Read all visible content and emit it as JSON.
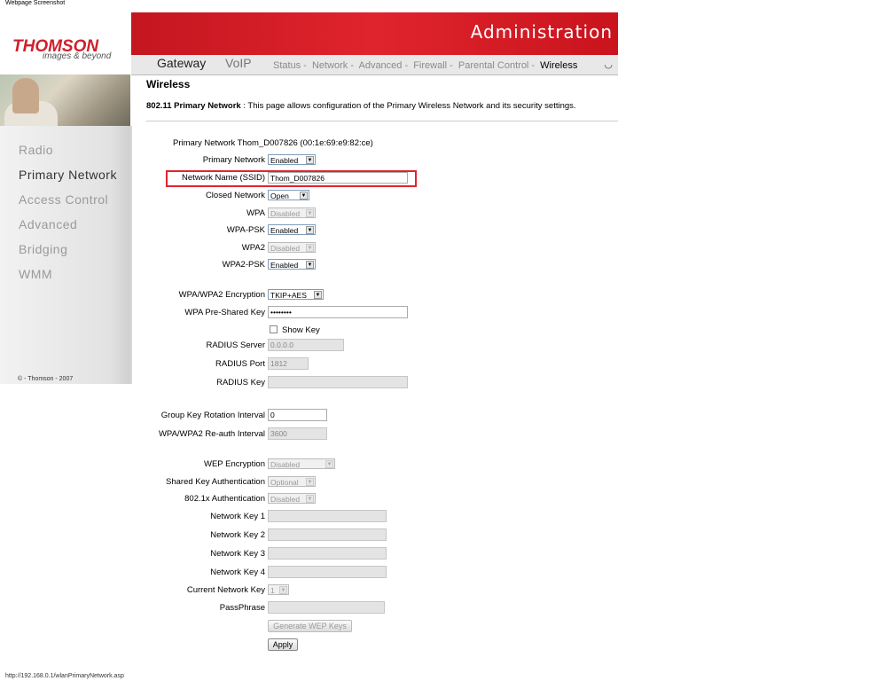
{
  "window": {
    "caption": "Webpage Screenshot",
    "status_url": "http://192.168.0.1/wlanPrimaryNetwork.asp"
  },
  "brand": {
    "name": "THOMSON",
    "tagline": "images & beyond",
    "banner_title": "Administration",
    "accent": "#e0242d"
  },
  "top_tabs": [
    "Gateway",
    "VoIP"
  ],
  "subnav": [
    {
      "label": "Status -"
    },
    {
      "label": "Network -"
    },
    {
      "label": "Advanced -"
    },
    {
      "label": "Firewall -"
    },
    {
      "label": "Parental Control -"
    },
    {
      "label": "Wireless"
    }
  ],
  "sidebar": {
    "items": [
      "Radio",
      "Primary Network",
      "Access Control",
      "Advanced",
      "Bridging",
      "WMM"
    ],
    "active": "Primary Network",
    "copyright": "© - Thomson - 2007"
  },
  "page": {
    "title": "Wireless",
    "desc_bold": "802.11 Primary Network",
    "desc_text": ":  This page allows configuration of the Primary Wireless Network and its security settings."
  },
  "form": {
    "primary_network_info": "Primary Network Thom_D007826 (00:1e:69:e9:82:ce)",
    "primary_network": {
      "label": "Primary Network",
      "value": "Enabled"
    },
    "ssid": {
      "label": "Network Name (SSID)",
      "value": "Thom_D007826"
    },
    "closed_network": {
      "label": "Closed Network",
      "value": "Open"
    },
    "wpa": {
      "label": "WPA",
      "value": "Disabled"
    },
    "wpa_psk": {
      "label": "WPA-PSK",
      "value": "Enabled"
    },
    "wpa2": {
      "label": "WPA2",
      "value": "Disabled"
    },
    "wpa2_psk": {
      "label": "WPA2-PSK",
      "value": "Enabled"
    },
    "encryption": {
      "label": "WPA/WPA2 Encryption",
      "value": "TKIP+AES"
    },
    "psk": {
      "label": "WPA Pre-Shared Key",
      "value": "••••••••"
    },
    "show_key": {
      "label": "Show Key"
    },
    "radius_server": {
      "label": "RADIUS Server",
      "value": "0.0.0.0"
    },
    "radius_port": {
      "label": "RADIUS Port",
      "value": "1812"
    },
    "radius_key": {
      "label": "RADIUS Key",
      "value": ""
    },
    "group_key": {
      "label": "Group Key Rotation Interval",
      "value": "0"
    },
    "reauth": {
      "label": "WPA/WPA2 Re-auth Interval",
      "value": "3600"
    },
    "wep_encryption": {
      "label": "WEP Encryption",
      "value": "Disabled"
    },
    "shared_key_auth": {
      "label": "Shared Key Authentication",
      "value": "Optional"
    },
    "dot1x_auth": {
      "label": "802.1x Authentication",
      "value": "Disabled"
    },
    "key1": {
      "label": "Network Key 1",
      "value": ""
    },
    "key2": {
      "label": "Network Key 2",
      "value": ""
    },
    "key3": {
      "label": "Network Key 3",
      "value": ""
    },
    "key4": {
      "label": "Network Key 4",
      "value": ""
    },
    "current_key": {
      "label": "Current Network Key",
      "value": "1"
    },
    "passphrase": {
      "label": "PassPhrase",
      "value": ""
    },
    "generate_btn": "Generate WEP Keys",
    "apply_btn": "Apply"
  }
}
